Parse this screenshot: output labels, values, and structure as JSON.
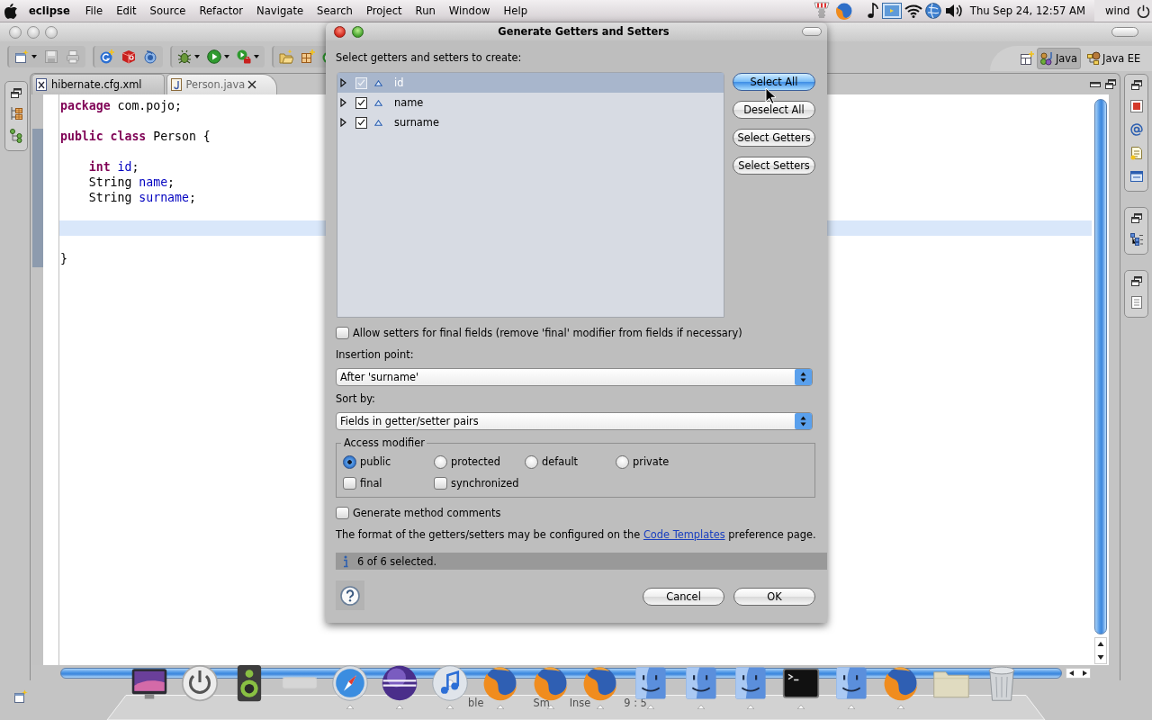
{
  "menubar": {
    "app_name": "eclipse",
    "menus": [
      "File",
      "Edit",
      "Source",
      "Refactor",
      "Navigate",
      "Search",
      "Project",
      "Run",
      "Window",
      "Help"
    ],
    "clock": "Thu Sep 24, 12:57 AM",
    "user": "wind"
  },
  "perspectives": [
    {
      "label": "Java",
      "kind": "java",
      "selected": true
    },
    {
      "label": "Java EE",
      "kind": "javaee",
      "selected": false
    }
  ],
  "editor": {
    "tabs": [
      {
        "label": "hibernate.cfg.xml",
        "kind": "xml",
        "selected": false
      },
      {
        "label": "Person.java",
        "kind": "java",
        "selected": true
      }
    ],
    "lines": [
      {
        "current": false,
        "tokens": [
          {
            "kind": "keyword",
            "text": "package"
          },
          {
            "kind": "plain",
            "text": " com.pojo;"
          }
        ]
      },
      {
        "current": false
      },
      {
        "current": false,
        "tokens": [
          {
            "kind": "keyword",
            "text": "public class"
          },
          {
            "kind": "plain",
            "text": " Person {"
          }
        ],
        "children": [
          {
            "current": false
          },
          {
            "current": false,
            "tokens": [
              {
                "kind": "keyword",
                "text": "int"
              },
              {
                "kind": "field",
                "text": " id"
              },
              {
                "kind": "plain",
                "text": ";"
              }
            ]
          },
          {
            "current": false,
            "tokens": [
              {
                "kind": "plain",
                "text": "String "
              },
              {
                "kind": "field",
                "text": "name"
              },
              {
                "kind": "plain",
                "text": ";"
              }
            ]
          },
          {
            "current": false,
            "tokens": [
              {
                "kind": "plain",
                "text": "String "
              },
              {
                "kind": "field",
                "text": "surname"
              },
              {
                "kind": "plain",
                "text": ";"
              }
            ]
          },
          {
            "current": false
          },
          {
            "current": true
          },
          {
            "current": false
          }
        ]
      },
      {
        "current": false,
        "tokens": [
          {
            "kind": "plain",
            "text": "}"
          }
        ]
      }
    ]
  },
  "status_bar": [
    "ble",
    "Sm",
    "Inse",
    "9 : 5"
  ],
  "dialog": {
    "title": "Generate Getters and Setters",
    "list_label": "Select getters and setters to create:",
    "fields": [
      {
        "name": "id",
        "selected": true,
        "checked": true,
        "expanded": false
      },
      {
        "name": "name",
        "selected": false,
        "checked": true,
        "expanded": false
      },
      {
        "name": "surname",
        "selected": false,
        "checked": true,
        "expanded": false
      }
    ],
    "side_buttons": [
      {
        "label": "Select All",
        "focused": true
      },
      {
        "label": "Deselect All",
        "focused": false
      },
      {
        "label": "Select Getters",
        "focused": false
      },
      {
        "label": "Select Setters",
        "focused": false
      }
    ],
    "allow_final": {
      "label": "Allow setters for final fields (remove 'final' modifier from fields if necessary)",
      "checked": false
    },
    "insertion_point": {
      "label": "Insertion point:",
      "value": "After 'surname'"
    },
    "sort_by": {
      "label": "Sort by:",
      "value": "Fields in getter/setter pairs"
    },
    "access_modifier": {
      "title": "Access modifier",
      "options": [
        {
          "label": "public",
          "selected": true
        },
        {
          "label": "protected",
          "selected": false
        },
        {
          "label": "default",
          "selected": false
        },
        {
          "label": "private",
          "selected": false
        }
      ],
      "modifiers": [
        {
          "label": "final",
          "checked": false
        },
        {
          "label": "synchronized",
          "checked": false
        }
      ]
    },
    "method_comments": {
      "label": "Generate method comments",
      "checked": false
    },
    "note": {
      "before": "The format of the getters/setters may be configured on the ",
      "link": "Code Templates",
      "after": " preference page."
    },
    "status": "6 of 6 selected.",
    "buttons": [
      "Cancel",
      "OK"
    ]
  },
  "dock": [
    {
      "kind": "screen",
      "running": false
    },
    {
      "kind": "power",
      "running": false
    },
    {
      "kind": "speaker",
      "running": false
    },
    {
      "kind": "tile",
      "running": false
    },
    {
      "kind": "compass",
      "running": true
    },
    {
      "kind": "sphere",
      "running": true
    },
    {
      "kind": "disc",
      "running": true
    },
    {
      "kind": "fox",
      "running": true
    },
    {
      "kind": "fox",
      "running": true
    },
    {
      "kind": "fox",
      "running": true
    },
    {
      "kind": "face",
      "running": true
    },
    {
      "kind": "face",
      "running": true
    },
    {
      "kind": "face",
      "running": true
    },
    {
      "kind": "terminal",
      "running": true
    },
    {
      "kind": "face",
      "running": true
    },
    {
      "kind": "fox",
      "running": true
    },
    {
      "kind": "folder",
      "running": false
    },
    {
      "kind": "trash",
      "running": false
    }
  ]
}
